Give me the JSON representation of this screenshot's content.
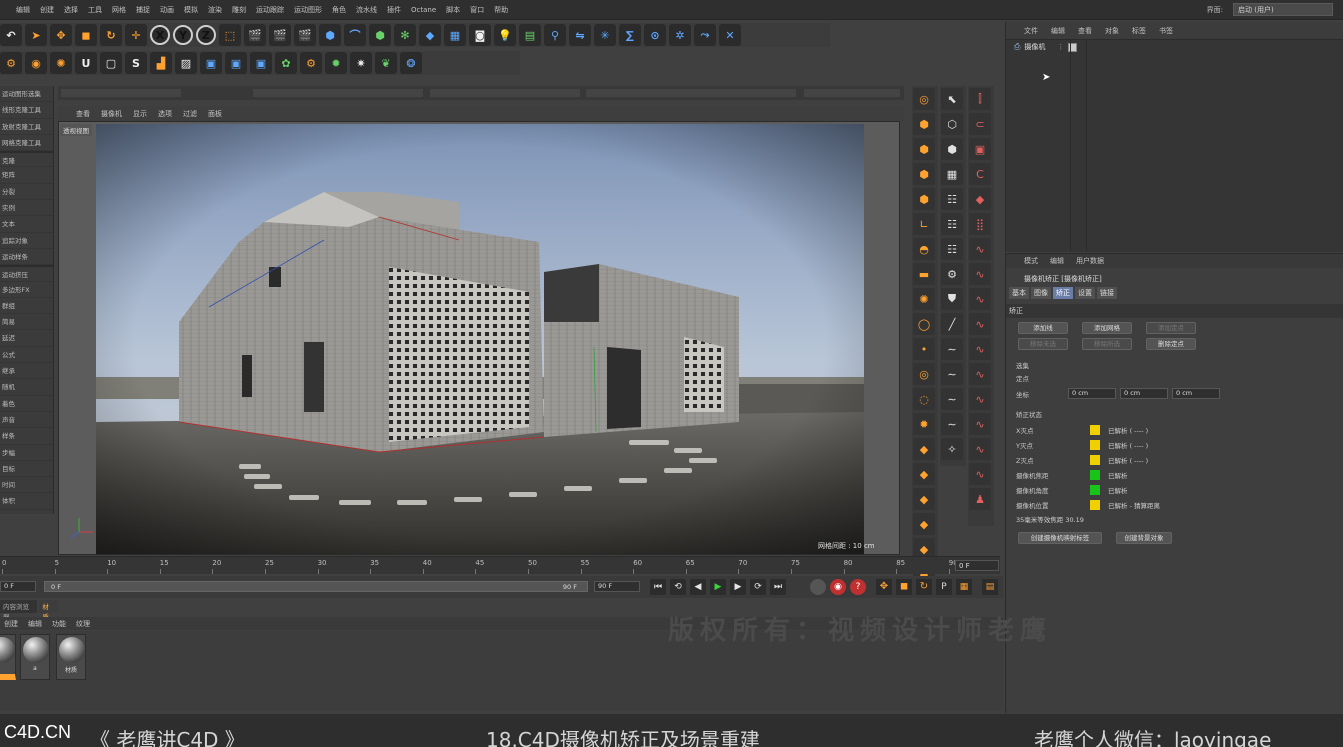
{
  "menubar": {
    "items": [
      "编辑",
      "创建",
      "选择",
      "工具",
      "网格",
      "捕捉",
      "动画",
      "模拟",
      "渲染",
      "雕刻",
      "运动跟踪",
      "运动图形",
      "角色",
      "流水线",
      "插件",
      "Octane",
      "脚本",
      "窗口",
      "帮助"
    ],
    "layout_label": "界面:",
    "layout_value": "启动 (用户)"
  },
  "toolbar": {
    "row1": [
      {
        "icon": "undo-icon",
        "glyph": "↶",
        "color": "white"
      },
      {
        "icon": "select-arrow-icon",
        "glyph": "➤",
        "color": "orange"
      },
      {
        "icon": "move-icon",
        "glyph": "✥",
        "color": "orange"
      },
      {
        "icon": "scale-icon",
        "glyph": "◼",
        "color": "orange"
      },
      {
        "icon": "rotate-icon",
        "glyph": "↻",
        "color": "orange"
      },
      {
        "icon": "recent-tool-icon",
        "glyph": "✛",
        "color": "orange"
      },
      {
        "icon": "x-axis-icon",
        "glyph": "X",
        "color": "round"
      },
      {
        "icon": "y-axis-icon",
        "glyph": "Y",
        "color": "round"
      },
      {
        "icon": "z-axis-icon",
        "glyph": "Z",
        "color": "round"
      },
      {
        "icon": "coord-system-icon",
        "glyph": "⬚",
        "color": "orange"
      },
      {
        "icon": "render-view-icon",
        "glyph": "🎬",
        "color": "white"
      },
      {
        "icon": "render-picture-viewer-icon",
        "glyph": "🎬",
        "color": "white"
      },
      {
        "icon": "render-settings-icon",
        "glyph": "🎬",
        "color": "white"
      },
      {
        "icon": "cube-icon",
        "glyph": "⬢",
        "color": "blue"
      },
      {
        "icon": "pen-spline-icon",
        "glyph": "⌒",
        "color": "blue"
      },
      {
        "icon": "subdivision-icon",
        "glyph": "⬢",
        "color": "green"
      },
      {
        "icon": "cloner-icon",
        "glyph": "✻",
        "color": "green"
      },
      {
        "icon": "deformer-icon",
        "glyph": "◆",
        "color": "blue"
      },
      {
        "icon": "floor-icon",
        "glyph": "▦",
        "color": "blue"
      },
      {
        "icon": "camera-icon",
        "glyph": "◙",
        "color": "white"
      },
      {
        "icon": "light-icon",
        "glyph": "💡",
        "color": "white"
      },
      {
        "icon": "plane-grid-icon",
        "glyph": "▤",
        "color": "green"
      },
      {
        "icon": "joint-icon",
        "glyph": "⚲",
        "color": "blue"
      },
      {
        "icon": "connect-icon",
        "glyph": "⇋",
        "color": "blue"
      },
      {
        "icon": "emitter-icon",
        "glyph": "✳",
        "color": "blue"
      },
      {
        "icon": "spline-wrap-icon",
        "glyph": "∑",
        "color": "blue"
      },
      {
        "icon": "target-icon",
        "glyph": "⊙",
        "color": "blue"
      },
      {
        "icon": "particles-icon",
        "glyph": "✲",
        "color": "blue"
      },
      {
        "icon": "gravity-icon",
        "glyph": "⤳",
        "color": "blue"
      },
      {
        "icon": "close-x-icon",
        "glyph": "✕",
        "color": "blue"
      }
    ],
    "row2": [
      {
        "icon": "octane-settings-icon",
        "glyph": "⚙",
        "color": "orange"
      },
      {
        "icon": "octane-live-viewer-icon",
        "glyph": "◉",
        "color": "orange"
      },
      {
        "icon": "octane-gear-icon",
        "glyph": "✺",
        "color": "orange"
      },
      {
        "icon": "octane-u-icon",
        "glyph": "U",
        "color": "white"
      },
      {
        "icon": "octane-square-icon",
        "glyph": "▢",
        "color": "white"
      },
      {
        "icon": "octane-s-icon",
        "glyph": "S",
        "color": "white"
      },
      {
        "icon": "octane-tag-icon",
        "glyph": "▟",
        "color": "orange"
      },
      {
        "icon": "octane-hatch-icon",
        "glyph": "▨",
        "color": "white"
      },
      {
        "icon": "octane-window-icon",
        "glyph": "▣",
        "color": "blue"
      },
      {
        "icon": "octane-preview-icon",
        "glyph": "▣",
        "color": "blue"
      },
      {
        "icon": "octane-image-icon",
        "glyph": "▣",
        "color": "blue"
      },
      {
        "icon": "octane-material-icon",
        "glyph": "✿",
        "color": "green"
      },
      {
        "icon": "octane-render-icon",
        "glyph": "⚙",
        "color": "orange"
      },
      {
        "icon": "octane-sun-icon",
        "glyph": "✹",
        "color": "green"
      },
      {
        "icon": "octane-star-icon",
        "glyph": "✷",
        "color": "white"
      },
      {
        "icon": "octane-tree-icon",
        "glyph": "❦",
        "color": "green"
      },
      {
        "icon": "octane-globe-icon",
        "glyph": "❂",
        "color": "blue"
      }
    ]
  },
  "left_panel": {
    "items": [
      "运动图形选集",
      "线形克隆工具",
      "放射克隆工具",
      "网格克隆工具",
      "克隆",
      "矩阵",
      "分裂",
      "实例",
      "文本",
      "追踪对象",
      "运动样条",
      "运动挤压",
      "多边形FX",
      "群组",
      "简易",
      "延迟",
      "公式",
      "继承",
      "随机",
      "着色",
      "声音",
      "样条",
      "步幅",
      "目标",
      "时间",
      "体积"
    ],
    "separator_after": [
      3,
      10
    ]
  },
  "viewport": {
    "menu": [
      "查看",
      "摄像机",
      "显示",
      "选项",
      "过滤",
      "面板"
    ],
    "tag": "透视视图",
    "grid_readout": "网格间距 : 10 cm"
  },
  "object_manager": {
    "menu": [
      "文件",
      "编辑",
      "查看",
      "对象",
      "标签",
      "书签"
    ],
    "object_name": "摄像机"
  },
  "attribute_manager": {
    "menu": [
      "模式",
      "编辑",
      "用户数据"
    ],
    "title": "摄像机矫正 [摄像机矫正]",
    "tabs": [
      "基本",
      "图像",
      "矫正",
      "设置",
      "链接"
    ],
    "active_tab": 2,
    "section_title": "矫正",
    "buttons_row1": [
      {
        "label": "添加线",
        "dim": false
      },
      {
        "label": "添加网格",
        "dim": false
      },
      {
        "label": "添加定点",
        "dim": true
      }
    ],
    "buttons_row2": [
      {
        "label": "移除未选",
        "dim": true
      },
      {
        "label": "移除所选",
        "dim": true
      },
      {
        "label": "删除定点",
        "dim": false
      }
    ],
    "select_label": "选集",
    "fixed_label": "定点",
    "coord_label": "坐标",
    "coord_values": [
      "0 cm",
      "0 cm",
      "0 cm"
    ],
    "status_section": "矫正状态",
    "status_rows": [
      {
        "label": "X灭点",
        "color": "#f0d000",
        "value": "已解析 ( ---- )"
      },
      {
        "label": "Y灭点",
        "color": "#f0d000",
        "value": "已解析 ( ---- )"
      },
      {
        "label": "Z灭点",
        "color": "#f0d000",
        "value": "已解析 ( ---- )"
      },
      {
        "label": "摄像机焦距",
        "color": "#19c419",
        "value": "已解析"
      },
      {
        "label": "摄像机角度",
        "color": "#19c419",
        "value": "已解析"
      },
      {
        "label": "摄像机位置",
        "color": "#f0d000",
        "value": "已解析 - 猜算距离"
      }
    ],
    "focal_readout": "35毫米等效焦距 30.19",
    "bottom_buttons": [
      "创建摄像机映射标签",
      "创建背景对象"
    ]
  },
  "timeline": {
    "ticks": [
      "0",
      "5",
      "10",
      "15",
      "20",
      "25",
      "30",
      "35",
      "40",
      "45",
      "50",
      "55",
      "60",
      "65",
      "70",
      "75",
      "80",
      "85",
      "90"
    ],
    "current_frame": "0 F"
  },
  "playback": {
    "start_field": "0 F",
    "range_start": "0 F",
    "range_end": "90 F",
    "end_field": "90 F",
    "buttons": [
      {
        "icon": "goto-start-icon",
        "glyph": "⏮"
      },
      {
        "icon": "prev-key-icon",
        "glyph": "⟲"
      },
      {
        "icon": "prev-frame-icon",
        "glyph": "◀"
      },
      {
        "icon": "play-icon",
        "glyph": "▶"
      },
      {
        "icon": "next-frame-icon",
        "glyph": "▶"
      },
      {
        "icon": "next-key-icon",
        "glyph": "⟳"
      },
      {
        "icon": "goto-end-icon",
        "glyph": "⏭"
      }
    ]
  },
  "material_manager": {
    "tabs": [
      "内容浏览器",
      "材质"
    ],
    "active_tab": 1,
    "menu": [
      "创建",
      "编辑",
      "功能",
      "纹理"
    ],
    "materials": [
      {
        "label": ""
      },
      {
        "label": "a"
      },
      {
        "label": "材质"
      }
    ]
  },
  "watermark": "版权所有：视频设计师老鹰",
  "footer": {
    "brand": "C4D.CN",
    "series": "《 老鹰讲C4D 》",
    "episode": "18.C4D摄像机矫正及场景重建",
    "contact": "老鹰个人微信：laoyingae"
  },
  "colors": {
    "active_tab": "#6a7da8",
    "status_yellow": "#f0d000",
    "status_green": "#19c419",
    "accent_orange": "#ffa230"
  }
}
